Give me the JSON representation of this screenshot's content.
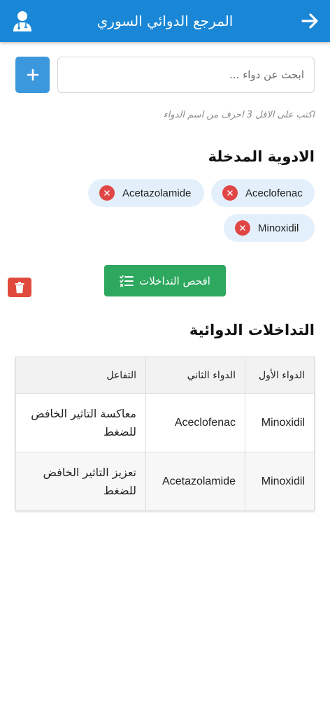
{
  "header": {
    "title": "المرجع الدوائي السوري",
    "back_icon": "arrow-right-icon",
    "profile_icon": "doctor-icon",
    "color": "#1a87d6"
  },
  "search": {
    "placeholder": "ابحث عن دواء ...",
    "value": "",
    "add_icon": "plus-icon",
    "hint": "اكتب على الاقل 3 احرف من اسم الدواء"
  },
  "selected": {
    "title": "الادوية المدخلة",
    "drugs": [
      "Aceclofenac",
      "Acetazolamide",
      "Minoxidil"
    ],
    "remove_icon": "close-icon"
  },
  "actions": {
    "check_label": "افحص التداخلات",
    "check_icon": "checklist-icon",
    "check_color": "#2ea85f",
    "delete_icon": "trash-icon",
    "delete_color": "#e04a3c"
  },
  "interactions": {
    "title": "التداخلات الدوائية",
    "columns": [
      "الدواء الأول",
      "الدواء الثاني",
      "التفاعل"
    ],
    "rows": [
      [
        "Minoxidil",
        "Aceclofenac",
        "معاكسة التاثير الخافض للضغط"
      ],
      [
        "Minoxidil",
        "Acetazolamide",
        "تعزيز التاثير الخافض للضغط"
      ]
    ]
  }
}
